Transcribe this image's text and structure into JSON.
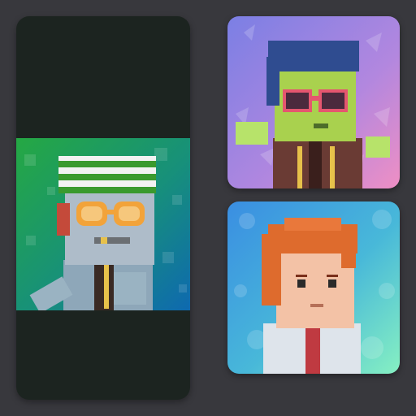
{
  "gallery": {
    "cards": [
      {
        "id": "main",
        "icon": "avatar-green-hat-icon",
        "background": "#1c2420",
        "art_bg": [
          "#1e8a3a",
          "#0f6e9c"
        ]
      },
      {
        "id": "top",
        "icon": "avatar-sunglasses-icon",
        "art_bg": [
          "#7a7ae0",
          "#e98ec7"
        ]
      },
      {
        "id": "bottom",
        "icon": "avatar-redhead-icon",
        "art_bg": [
          "#3e8fe0",
          "#7ee6c5"
        ]
      }
    ]
  },
  "colors": {
    "page_bg": "#38383d",
    "dark_panel": "#1c2420"
  }
}
